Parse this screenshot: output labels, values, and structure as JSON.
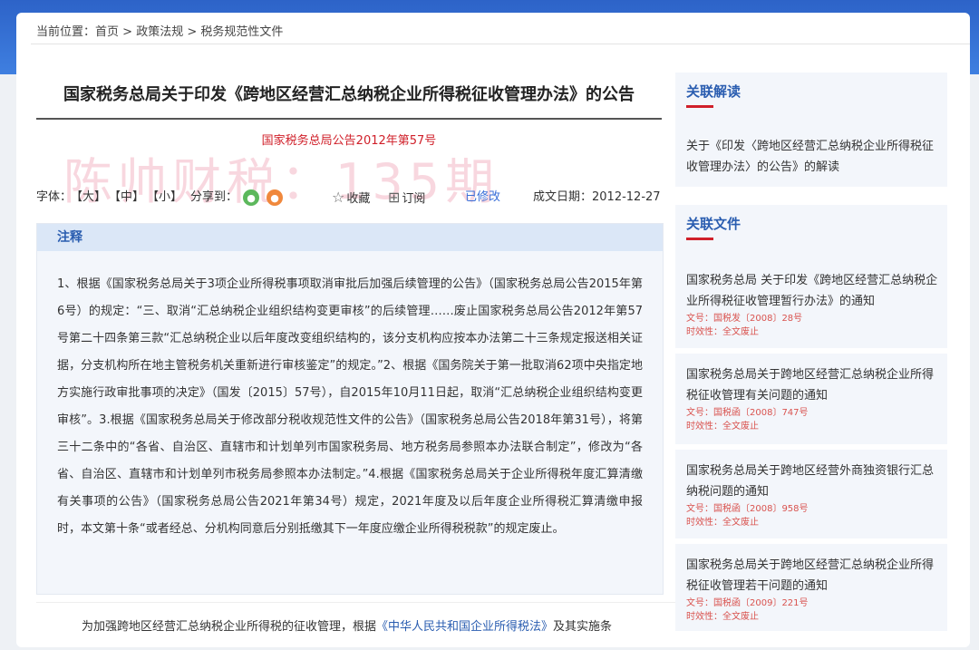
{
  "breadcrumb": {
    "prefix": "当前位置：",
    "home": "首页",
    "sep1": " > ",
    "section": "政策法规",
    "sep2": " > ",
    "current": "税务规范性文件"
  },
  "article": {
    "title": "国家税务总局关于印发《跨地区经营汇总纳税企业所得税征收管理办法》的公告",
    "doc_number": "国家税务总局公告2012年第57号",
    "watermark": "陈帅财税：135期"
  },
  "toolbar": {
    "font_label": "字体：",
    "font_large": "【大】",
    "font_medium": "【中】",
    "font_small": "【小】",
    "share_label": "分享到：",
    "favorite": "收藏",
    "subscribe": "订阅",
    "modified": "已修改",
    "date_label": "成文日期：2012-12-27"
  },
  "note": {
    "header": "注释",
    "text": "1、根据《国家税务总局关于3项企业所得税事项取消审批后加强后续管理的公告》（国家税务总局公告2015年第6号）的规定：“三、取消“汇总纳税企业组织结构变更审核”的后续管理……废止国家税务总局公告2012年第57号第二十四条第三款“汇总纳税企业以后年度改变组织结构的，该分支机构应按本办法第二十三条规定报送相关证据，分支机构所在地主管税务机关重新进行审核鉴定”的规定。”2、根据《国务院关于第一批取消62项中央指定地方实施行政审批事项的决定》（国发〔2015〕57号），自2015年10月11日起，取消“汇总纳税企业组织结构变更审核”。3.根据《国家税务总局关于修改部分税收规范性文件的公告》（国家税务总局公告2018年第31号），将第三十二条中的“各省、自治区、直辖市和计划单列市国家税务局、地方税务局参照本办法联合制定”，修改为“各省、自治区、直辖市和计划单列市税务局参照本办法制定。”4.根据《国家税务总局关于企业所得税年度汇算清缴有关事项的公告》（国家税务总局公告2021年第34号）规定，2021年度及以后年度企业所得税汇算清缴申报时，本文第十条“或者经总、分机构同意后分别抵缴其下一年度应缴企业所得税税款”的规定废止。"
  },
  "body": {
    "text_before": "为加强跨地区经营汇总纳税企业所得税的征收管理，根据",
    "link": "《中华人民共和国企业所得税法》",
    "text_after": "及其实施条"
  },
  "sidebar": {
    "reading_title": "关联解读",
    "reading_item": "关于《印发〈跨地区经营汇总纳税企业所得税征收管理办法〉的公告》的解读",
    "files_title": "关联文件",
    "files": [
      {
        "title": "国家税务总局 关于印发《跨地区经营汇总纳税企业所得税征收管理暂行办法》的通知",
        "doc": "文号：国税发〔2008〕28号",
        "status": "时效性：全文废止"
      },
      {
        "title": "国家税务总局关于跨地区经营汇总纳税企业所得税征收管理有关问题的通知",
        "doc": "文号：国税函〔2008〕747号",
        "status": "时效性：全文废止"
      },
      {
        "title": "国家税务总局关于跨地区经营外商独资银行汇总纳税问题的通知",
        "doc": "文号：国税函〔2008〕958号",
        "status": "时效性：全文废止"
      },
      {
        "title": "国家税务总局关于跨地区经营汇总纳税企业所得税征收管理若干问题的通知",
        "doc": "文号：国税函〔2009〕221号",
        "status": "时效性：全文废止"
      }
    ]
  }
}
